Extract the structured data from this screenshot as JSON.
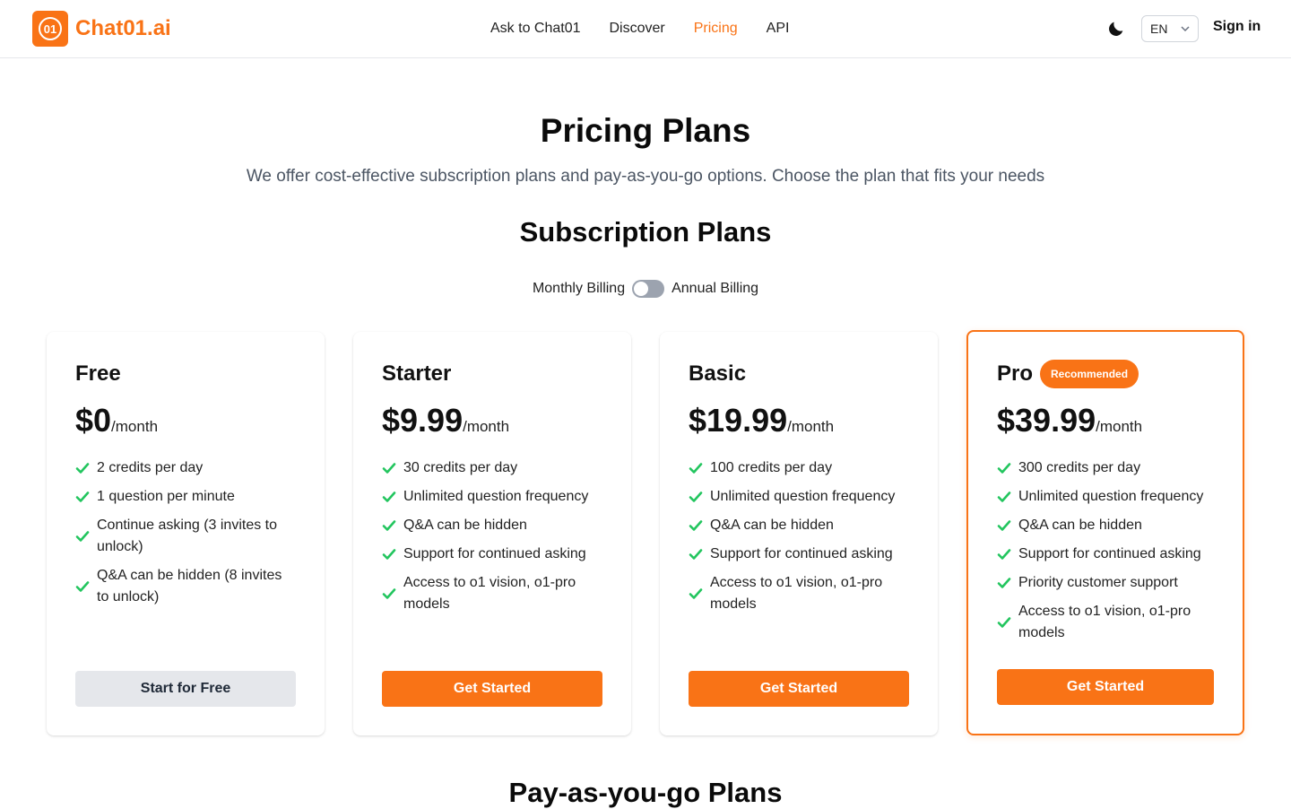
{
  "brand": {
    "mark": "01",
    "name": "Chat01.ai"
  },
  "nav": [
    {
      "label": "Ask to Chat01",
      "active": false
    },
    {
      "label": "Discover",
      "active": false
    },
    {
      "label": "Pricing",
      "active": true
    },
    {
      "label": "API",
      "active": false
    }
  ],
  "header": {
    "theme_icon": "moon-icon",
    "language": "EN",
    "signin": "Sign in"
  },
  "hero": {
    "title": "Pricing Plans",
    "subtitle": "We offer cost-effective subscription plans and pay-as-you-go options. Choose the plan that fits your needs"
  },
  "subscription": {
    "title": "Subscription Plans",
    "billing_monthly": "Monthly Billing",
    "billing_annual": "Annual Billing",
    "annual_enabled": false
  },
  "plans": [
    {
      "name": "Free",
      "price": "$0",
      "period": "/month",
      "badge": "",
      "features": [
        "2 credits per day",
        "1 question per minute",
        "Continue asking (3 invites to unlock)",
        "Q&A can be hidden (8 invites to unlock)"
      ],
      "cta": "Start for Free"
    },
    {
      "name": "Starter",
      "price": "$9.99",
      "period": "/month",
      "badge": "",
      "features": [
        "30 credits per day",
        "Unlimited question frequency",
        "Q&A can be hidden",
        "Support for continued asking",
        "Access to o1 vision, o1-pro models"
      ],
      "cta": "Get Started"
    },
    {
      "name": "Basic",
      "price": "$19.99",
      "period": "/month",
      "badge": "",
      "features": [
        "100 credits per day",
        "Unlimited question frequency",
        "Q&A can be hidden",
        "Support for continued asking",
        "Access to o1 vision, o1-pro models"
      ],
      "cta": "Get Started"
    },
    {
      "name": "Pro",
      "price": "$39.99",
      "period": "/month",
      "badge": "Recommended",
      "features": [
        "300 credits per day",
        "Unlimited question frequency",
        "Q&A can be hidden",
        "Support for continued asking",
        "Priority customer support",
        "Access to o1 vision, o1-pro models"
      ],
      "cta": "Get Started"
    }
  ],
  "payg": {
    "title": "Pay-as-you-go Plans"
  },
  "colors": {
    "accent": "#f97316",
    "check": "#22c55e",
    "muted_text": "#4b5563"
  }
}
